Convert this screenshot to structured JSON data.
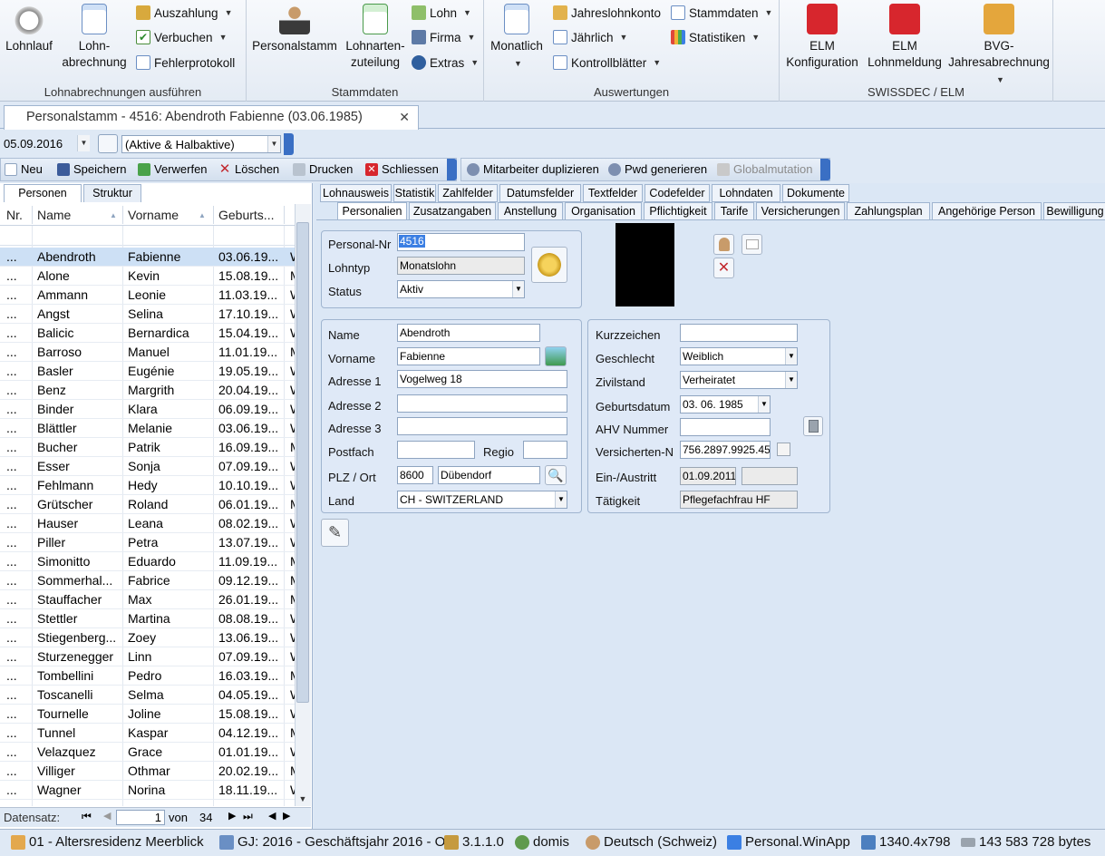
{
  "ribbon": {
    "groups": [
      {
        "label": "Lohnabrechnungen ausführen"
      },
      {
        "label": "Stammdaten"
      },
      {
        "label": "Auswertungen"
      },
      {
        "label": "SWISSDEC / ELM"
      }
    ],
    "lohnlauf": "Lohnlauf",
    "lohnabrechnung_1": "Lohn-",
    "lohnabrechnung_2": "abrechnung",
    "auszahlung": "Auszahlung",
    "verbuchen": "Verbuchen",
    "fehlerprotokoll": "Fehlerprotokoll",
    "personalstamm": "Personalstamm",
    "lohnarten_1": "Lohnarten-",
    "lohnarten_2": "zuteilung",
    "lohn": "Lohn",
    "firma": "Firma",
    "extras": "Extras",
    "monatlich": "Monatlich",
    "jahreslohnkonto": "Jahreslohnkonto",
    "jaehrlich": "Jährlich",
    "kontrollblaetter": "Kontrollblätter",
    "stammdaten": "Stammdaten",
    "statistiken": "Statistiken",
    "elm_konfig_1": "ELM",
    "elm_konfig_2": "Konfiguration",
    "elm_lohnmeldung_1": "ELM",
    "elm_lohnmeldung_2": "Lohnmeldung",
    "bvg_1": "BVG-",
    "bvg_2": "Jahresabrechnung"
  },
  "doc_tab": {
    "title": "Personalstamm - 4516: Abendroth Fabienne (03.06.1985)"
  },
  "filter": {
    "date": "05.09.2016",
    "status": "(Aktive & Halbaktive)"
  },
  "toolbar": {
    "neu": "Neu",
    "speichern": "Speichern",
    "verwerfen": "Verwerfen",
    "loeschen": "Löschen",
    "drucken": "Drucken",
    "schliessen": "Schliessen",
    "duplizieren": "Mitarbeiter duplizieren",
    "pwd": "Pwd generieren",
    "globalmutation": "Globalmutation"
  },
  "left_tabs": {
    "personen": "Personen",
    "struktur": "Struktur"
  },
  "grid": {
    "headers": {
      "nr": "Nr.",
      "name": "Name",
      "vorname": "Vorname",
      "geburts": "Geburts..."
    },
    "rows": [
      {
        "nr": "...",
        "name": "Abendroth",
        "vorname": "Fabienne",
        "geb": "03.06.19...",
        "extra": "W"
      },
      {
        "nr": "...",
        "name": "Alone",
        "vorname": "Kevin",
        "geb": "15.08.19...",
        "extra": "M"
      },
      {
        "nr": "...",
        "name": "Ammann",
        "vorname": "Leonie",
        "geb": "11.03.19...",
        "extra": "W"
      },
      {
        "nr": "...",
        "name": "Angst",
        "vorname": "Selina",
        "geb": "17.10.19...",
        "extra": "W"
      },
      {
        "nr": "...",
        "name": "Balicic",
        "vorname": "Bernardica",
        "geb": "15.04.19...",
        "extra": "W"
      },
      {
        "nr": "...",
        "name": "Barroso",
        "vorname": "Manuel",
        "geb": "11.01.19...",
        "extra": "M"
      },
      {
        "nr": "...",
        "name": "Basler",
        "vorname": "Eugénie",
        "geb": "19.05.19...",
        "extra": "W"
      },
      {
        "nr": "...",
        "name": "Benz",
        "vorname": "Margrith",
        "geb": "20.04.19...",
        "extra": "W"
      },
      {
        "nr": "...",
        "name": "Binder",
        "vorname": "Klara",
        "geb": "06.09.19...",
        "extra": "W"
      },
      {
        "nr": "...",
        "name": "Blättler",
        "vorname": "Melanie",
        "geb": "03.06.19...",
        "extra": "W"
      },
      {
        "nr": "...",
        "name": "Bucher",
        "vorname": "Patrik",
        "geb": "16.09.19...",
        "extra": "M"
      },
      {
        "nr": "...",
        "name": "Esser",
        "vorname": "Sonja",
        "geb": "07.09.19...",
        "extra": "W"
      },
      {
        "nr": "...",
        "name": "Fehlmann",
        "vorname": "Hedy",
        "geb": "10.10.19...",
        "extra": "W"
      },
      {
        "nr": "...",
        "name": "Grütscher",
        "vorname": "Roland",
        "geb": "06.01.19...",
        "extra": "M"
      },
      {
        "nr": "...",
        "name": "Hauser",
        "vorname": "Leana",
        "geb": "08.02.19...",
        "extra": "W"
      },
      {
        "nr": "...",
        "name": "Piller",
        "vorname": "Petra",
        "geb": "13.07.19...",
        "extra": "W"
      },
      {
        "nr": "...",
        "name": "Simonitto",
        "vorname": "Eduardo",
        "geb": "11.09.19...",
        "extra": "M"
      },
      {
        "nr": "...",
        "name": "Sommerhal...",
        "vorname": "Fabrice",
        "geb": "09.12.19...",
        "extra": "M"
      },
      {
        "nr": "...",
        "name": "Stauffacher",
        "vorname": "Max",
        "geb": "26.01.19...",
        "extra": "M"
      },
      {
        "nr": "...",
        "name": "Stettler",
        "vorname": "Martina",
        "geb": "08.08.19...",
        "extra": "W"
      },
      {
        "nr": "...",
        "name": "Stiegenberg...",
        "vorname": "Zoey",
        "geb": "13.06.19...",
        "extra": "W"
      },
      {
        "nr": "...",
        "name": "Sturzenegger",
        "vorname": "Linn",
        "geb": "07.09.19...",
        "extra": "W"
      },
      {
        "nr": "...",
        "name": "Tombellini",
        "vorname": "Pedro",
        "geb": "16.03.19...",
        "extra": "M"
      },
      {
        "nr": "...",
        "name": "Toscanelli",
        "vorname": "Selma",
        "geb": "04.05.19...",
        "extra": "W"
      },
      {
        "nr": "...",
        "name": "Tournelle",
        "vorname": "Joline",
        "geb": "15.08.19...",
        "extra": "W"
      },
      {
        "nr": "...",
        "name": "Tunnel",
        "vorname": "Kaspar",
        "geb": "04.12.19...",
        "extra": "M"
      },
      {
        "nr": "...",
        "name": "Velazquez",
        "vorname": "Grace",
        "geb": "01.01.19...",
        "extra": "W"
      },
      {
        "nr": "...",
        "name": "Villiger",
        "vorname": "Othmar",
        "geb": "20.02.19...",
        "extra": "M"
      },
      {
        "nr": "...",
        "name": "Wagner",
        "vorname": "Norina",
        "geb": "18.11.19...",
        "extra": "W"
      }
    ]
  },
  "nav": {
    "label": "Datensatz:",
    "current": "1",
    "von": "von",
    "total": "34"
  },
  "tabs_row1": [
    "Lohnausweis",
    "Statistik",
    "Zahlfelder",
    "Datumsfelder",
    "Textfelder",
    "Codefelder",
    "Lohndaten",
    "Dokumente"
  ],
  "tabs_row2": [
    "Personalien",
    "Zusatzangaben",
    "Anstellung",
    "Organisation",
    "Pflichtigkeit",
    "Tarife",
    "Versicherungen",
    "Zahlungsplan",
    "Angehörige Person",
    "Bewilligung"
  ],
  "form": {
    "personal_nr_label": "Personal-Nr",
    "personal_nr": "4516",
    "lohntyp_label": "Lohntyp",
    "lohntyp": "Monatslohn",
    "status_label": "Status",
    "status": "Aktiv",
    "name_label": "Name",
    "name": "Abendroth",
    "vorname_label": "Vorname",
    "vorname": "Fabienne",
    "adresse1_label": "Adresse 1",
    "adresse1": "Vogelweg 18",
    "adresse2_label": "Adresse 2",
    "adresse2": "",
    "adresse3_label": "Adresse 3",
    "adresse3": "",
    "postfach_label": "Postfach",
    "postfach": "",
    "regio_label": "Regio",
    "regio": "",
    "plz_label": "PLZ / Ort",
    "plz": "8600",
    "ort": "Dübendorf",
    "land_label": "Land",
    "land": "CH - SWITZERLAND",
    "kurzzeichen_label": "Kurzzeichen",
    "kurzzeichen": "",
    "geschlecht_label": "Geschlecht",
    "geschlecht": "Weiblich",
    "zivilstand_label": "Zivilstand",
    "zivilstand": "Verheiratet",
    "geburtsdatum_label": "Geburtsdatum",
    "geburtsdatum": "03. 06. 1985",
    "ahv_label": "AHV Nummer",
    "ahv": "",
    "versicherten_label": "Versicherten-N",
    "versicherten": "756.2897.9925.45",
    "eintritt_label": "Ein-/Austritt",
    "eintritt": "01.09.2011",
    "austritt": "",
    "taetigkeit_label": "Tätigkeit",
    "taetigkeit": "Pflegefachfrau HF"
  },
  "status_bar": {
    "firma": "01 - Altersresidenz Meerblick",
    "gj": "GJ: 2016 - Geschäftsjahr 2016 - O",
    "version": "3.1.1.0",
    "user": "domis",
    "lang": "Deutsch (Schweiz)",
    "app": "Personal.WinApp",
    "res": "1340.4x798",
    "mem": "143 583 728 bytes"
  },
  "colors": {
    "accent": "#3b7fe3",
    "selected_row": "#cde0f5",
    "panel_bg": "#dbe7f5"
  }
}
